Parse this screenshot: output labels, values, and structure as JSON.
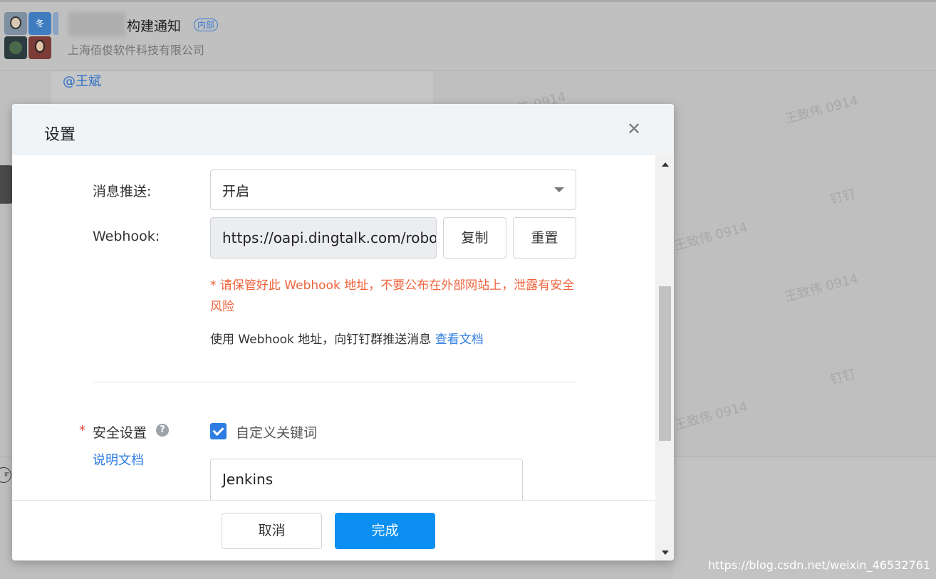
{
  "chat": {
    "group_name": "构建通知",
    "group_tag": "内部",
    "company": "上海佰俊软件科技有限公司",
    "avatar_badge": "冬",
    "mention": "@王斌"
  },
  "watermark": {
    "text_1": "王致伟 0914",
    "text_2": "钉钉"
  },
  "modal": {
    "title": "设置",
    "close_icon": "close-icon",
    "push_label": "消息推送:",
    "push_value": "开启",
    "webhook_label": "Webhook:",
    "webhook_value": "https://oapi.dingtalk.com/robot/send?access_token=",
    "copy_label": "复制",
    "reset_label": "重置",
    "warning_text": "* 请保管好此 Webhook 地址，不要公布在外部网站上，泄露有安全风险",
    "hint_text": "使用 Webhook 地址，向钉钉群推送消息 ",
    "hint_link": "查看文档",
    "security_star": "*",
    "security_label": "安全设置",
    "help_icon": "?",
    "doc_link": "说明文档",
    "keyword_checkbox_label": "自定义关键词",
    "keyword_checked": true,
    "keyword_value": "Jenkins",
    "cancel_label": "取消",
    "done_label": "完成"
  },
  "footer_url": "https://blog.csdn.net/weixin_46532761",
  "colors": {
    "primary": "#0b8ff0",
    "link": "#2e7de2",
    "warning": "#f0643c",
    "required": "#e0403c"
  }
}
